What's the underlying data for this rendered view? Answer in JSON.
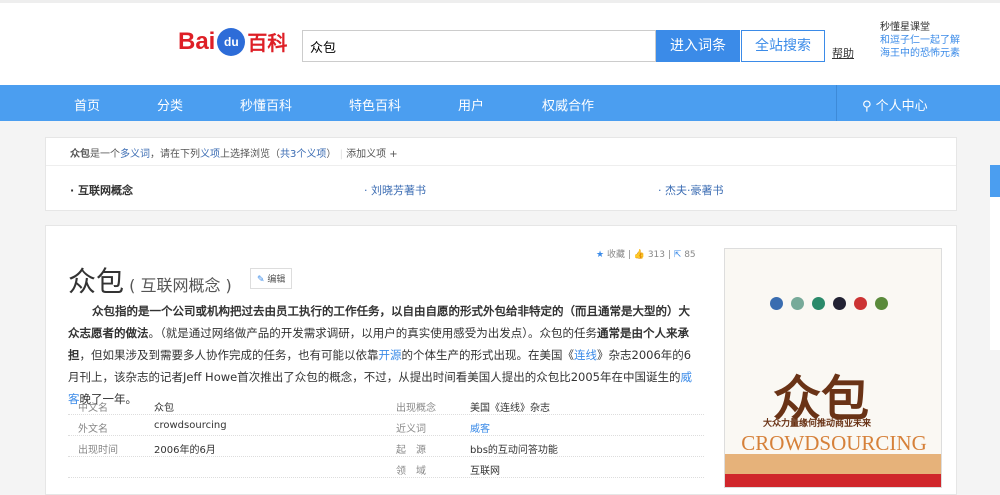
{
  "header": {
    "logo_text": "Bai",
    "logo_du": "du",
    "logo_baike": "百科",
    "search_value": "众包",
    "enter_button": "进入词条",
    "site_search_button": "全站搜索",
    "help_link": "帮助",
    "promo_title": "秒懂星课堂",
    "promo_line1": "和逗子仁一起了解",
    "promo_line2": "海王中的恐怖元素"
  },
  "nav": {
    "items": [
      "首页",
      "分类",
      "秒懂百科",
      "特色百科",
      "用户",
      "权威合作"
    ],
    "user_center": "个人中心"
  },
  "polysemy": {
    "term": "众包",
    "text1": "是一个",
    "link_multi": "多义词",
    "text2": "，请在下列",
    "link_item": "义项",
    "text3": "上选择浏览（",
    "count": "共3个义项",
    "text4": "）",
    "add": "添加义项",
    "senses": [
      "互联网概念",
      "刘晓芳著书",
      "杰夫·豪著书"
    ]
  },
  "article": {
    "collect": "收藏",
    "likes": "313",
    "shares": "85",
    "title": "众包",
    "subtitle": "互联网概念",
    "edit": "编辑",
    "p_bold1": "众包指的是一个公司或机构把过去由员工执行的工作任务，以自由自愿的形式外包给非特定的（而且通常是大型的）大众志愿者的做法",
    "p_t1": "。（就是通过网络做产品的开发需求调研，以用户的真实使用感受为出发点）。众包的任务",
    "p_bold2": "通常是由个人来承担",
    "p_t2": "，但如果涉及到需要多人协作完成的任务，也有可能以依靠",
    "p_link1": "开源",
    "p_t3": "的个体生产的形式出现。在美国《",
    "p_link2": "连线",
    "p_t4": "》杂志2006年的6月刊上，该杂志的记者Jeff Howe首次推出了众包的概念，不过，从提出时间看美国人提出的众包比2005年在中国诞生的",
    "p_link3": "威客",
    "p_t5": "晚了一年。"
  },
  "info": [
    {
      "k1": "中文名",
      "v1": "众包",
      "k2": "出现概念",
      "v2": "美国《连线》杂志"
    },
    {
      "k1": "外文名",
      "v1": "crowdsourcing",
      "k2": "近义词",
      "v2": "威客"
    },
    {
      "k1": "出现时间",
      "v1": "2006年的6月",
      "k2": "起　源",
      "v2": "bbs的互动问答功能"
    },
    {
      "k1": "",
      "v1": "",
      "k2": "领　域",
      "v2": "互联网"
    }
  ],
  "cover": {
    "title": "众包",
    "subtitle": "大众力量缘何推动商业未来",
    "en": "CROWDSOURCING"
  }
}
